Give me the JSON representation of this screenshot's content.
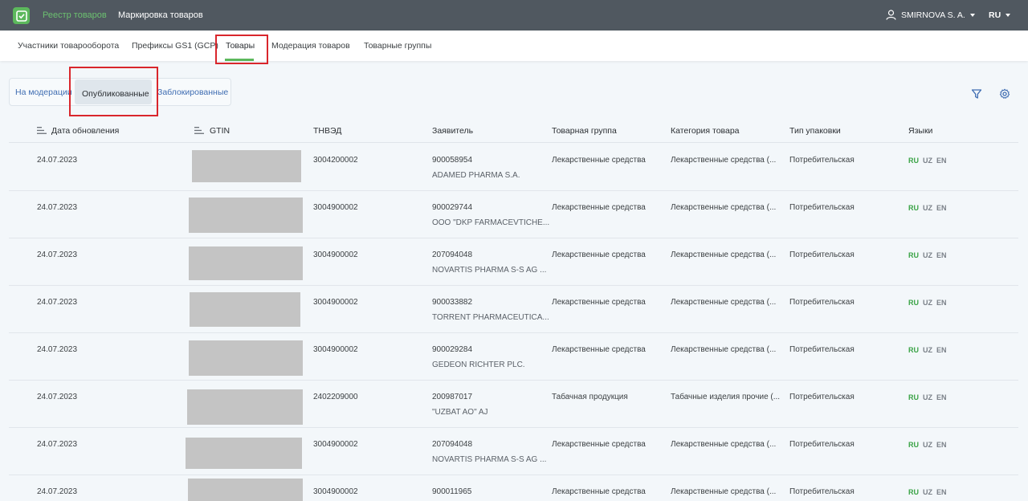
{
  "topbar": {
    "nav_active": "Реестр товаров",
    "nav_second": "Маркировка товаров",
    "user_name": "SMIRNOVA S. A.",
    "lang": "RU"
  },
  "subnav": {
    "tabs": [
      {
        "label": "Участники товарооборота"
      },
      {
        "label": "Префиксы GS1 (GCP)"
      },
      {
        "label": "Товары"
      },
      {
        "label": "Модерация товаров"
      },
      {
        "label": "Товарные группы"
      }
    ],
    "active_index": 2
  },
  "status_tabs": {
    "items": [
      {
        "label": "На модерации"
      },
      {
        "label": "Опубликованные"
      },
      {
        "label": "Заблокированные"
      }
    ],
    "active_index": 1
  },
  "table": {
    "columns": [
      {
        "label": "Дата обновления"
      },
      {
        "label": "GTIN"
      },
      {
        "label": "ТНВЭД"
      },
      {
        "label": "Заявитель"
      },
      {
        "label": "Товарная группа"
      },
      {
        "label": "Категория товара"
      },
      {
        "label": "Тип упаковки"
      },
      {
        "label": "Языки"
      }
    ],
    "rows": [
      {
        "date": "24.07.2023",
        "tnved": "3004200002",
        "tin": "900058954",
        "company": "ADAMED PHARMA S.A.",
        "group": "Лекарственные средства",
        "category": "Лекарственные средства (...",
        "pack": "Потребительская"
      },
      {
        "date": "24.07.2023",
        "tnved": "3004900002",
        "tin": "900029744",
        "company": "OOO \"DKP FARMACEVTICHE...",
        "group": "Лекарственные средства",
        "category": "Лекарственные средства (...",
        "pack": "Потребительская"
      },
      {
        "date": "24.07.2023",
        "tnved": "3004900002",
        "tin": "207094048",
        "company": "NOVARTIS PHARMA S-S AG ...",
        "group": "Лекарственные средства",
        "category": "Лекарственные средства (...",
        "pack": "Потребительская"
      },
      {
        "date": "24.07.2023",
        "tnved": "3004900002",
        "tin": "900033882",
        "company": "TORRENT PHARMACEUTICA...",
        "group": "Лекарственные средства",
        "category": "Лекарственные средства (...",
        "pack": "Потребительская"
      },
      {
        "date": "24.07.2023",
        "tnved": "3004900002",
        "tin": "900029284",
        "company": "GEDEON RICHTER PLC.",
        "group": "Лекарственные средства",
        "category": "Лекарственные средства (...",
        "pack": "Потребительская"
      },
      {
        "date": "24.07.2023",
        "tnved": "2402209000",
        "tin": "200987017",
        "company": "\"UZBAT AO\" AJ",
        "group": "Табачная продукция",
        "category": "Табачные изделия прочие (...",
        "pack": "Потребительская"
      },
      {
        "date": "24.07.2023",
        "tnved": "3004900002",
        "tin": "207094048",
        "company": "NOVARTIS PHARMA S-S AG ...",
        "group": "Лекарственные средства",
        "category": "Лекарственные средства (...",
        "pack": "Потребительская"
      },
      {
        "date": "24.07.2023",
        "tnved": "3004900002",
        "tin": "900011965",
        "company": "",
        "group": "Лекарственные средства",
        "category": "Лекарственные средства (...",
        "pack": "Потребительская"
      }
    ],
    "langs": {
      "ru": "RU",
      "uz": "UZ",
      "en": "EN"
    }
  },
  "colors": {
    "topbar": "#505860",
    "accent_green": "#5cb85c",
    "link_blue": "#3f6db2",
    "highlight_red": "#d9262c"
  },
  "icons": {
    "logo": "checkbox-logo-icon",
    "user": "user-icon",
    "filter": "filter-icon",
    "settings": "gear-icon",
    "sort": "sort-lines-icon"
  }
}
